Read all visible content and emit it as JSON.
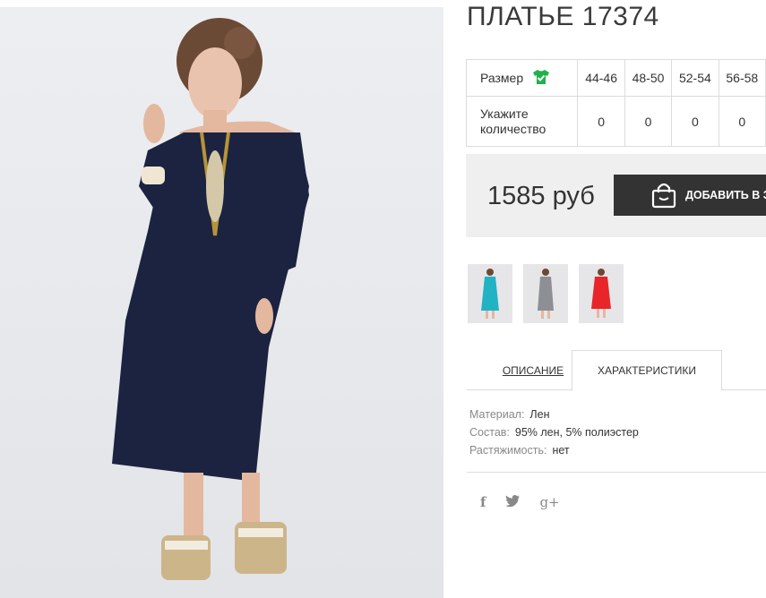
{
  "product": {
    "title": "ПЛАТЬЕ 17374"
  },
  "sizes": {
    "label": "Размер",
    "qty_label_line1": "Укажите",
    "qty_label_line2": "количество",
    "columns": [
      {
        "size": "44-46",
        "qty": "0"
      },
      {
        "size": "48-50",
        "qty": "0"
      },
      {
        "size": "52-54",
        "qty": "0"
      },
      {
        "size": "56-58",
        "qty": "0"
      }
    ]
  },
  "price": "1585 руб",
  "buttons": {
    "add_to_cart": "ДОБАВИТЬ В ЗАКАЗ"
  },
  "tabs": [
    {
      "label": "ОПИСАНИЕ",
      "active": false
    },
    {
      "label": "ХАРАКТЕРИСТИКИ",
      "active": true
    }
  ],
  "specs": [
    {
      "key": "Материал:",
      "value": "Лен"
    },
    {
      "key": "Состав:",
      "value": "95% лен, 5% полиэстер"
    },
    {
      "key": "Растяжимость:",
      "value": "нет"
    }
  ],
  "thumbnails": [
    {
      "dress_color": "#21b3c4"
    },
    {
      "dress_color": "#8e8f94"
    },
    {
      "dress_color": "#e8262a"
    }
  ],
  "social": [
    {
      "icon": "facebook-icon",
      "glyph": "f"
    },
    {
      "icon": "twitter-icon",
      "glyph": "🐦"
    },
    {
      "icon": "google-plus-icon",
      "glyph": "g+"
    }
  ],
  "colors": {
    "dress": "#1c2340",
    "button_bg": "#333333",
    "size_icon": "#22b14c"
  }
}
